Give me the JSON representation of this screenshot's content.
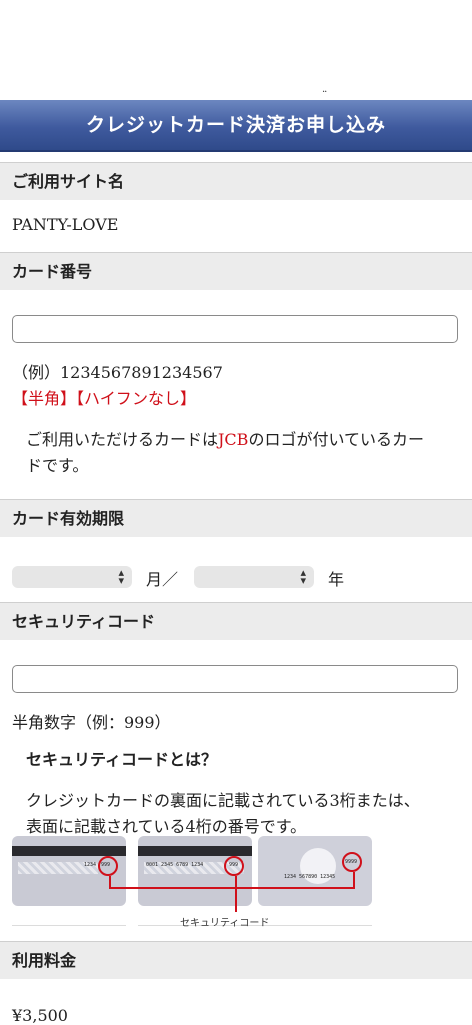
{
  "header": {
    "title": "クレジットカード決済お申し込み",
    "top_dots": ".."
  },
  "site": {
    "section_label": "ご利用サイト名",
    "value": "PANTY-LOVE"
  },
  "card_number": {
    "section_label": "カード番号",
    "value": "",
    "example": "（例）1234567891234567",
    "note_halfwidth": "【半角】",
    "note_no_hyphen": "【ハイフンなし】",
    "notice_pre": "ご利用いただけるカードは",
    "notice_brand": "JCB",
    "notice_post": "のロゴが付いているカー",
    "notice_line2": "ドです。"
  },
  "expiry": {
    "section_label": "カード有効期限",
    "month_value": "",
    "month_label": "月／",
    "year_value": "",
    "year_label": "年"
  },
  "security": {
    "section_label": "セキュリティコード",
    "value": "",
    "hint": "半角数字（例：999）",
    "what_heading": "セキュリティコードとは？",
    "desc_line1": "クレジットカードの裏面に記載されている3桁または、",
    "desc_line2": "表面に記載されている4桁の番号です。",
    "diagram_label": "セキュリティコード",
    "card1_number": "1234",
    "card1_code": "999",
    "card2_number": "0001 2345 6789 1234",
    "card2_code": "999",
    "card3_number": "1234 567890 12345",
    "card3_code": "9999"
  },
  "fee": {
    "section_label": "利用料金",
    "value": "¥3,500"
  }
}
